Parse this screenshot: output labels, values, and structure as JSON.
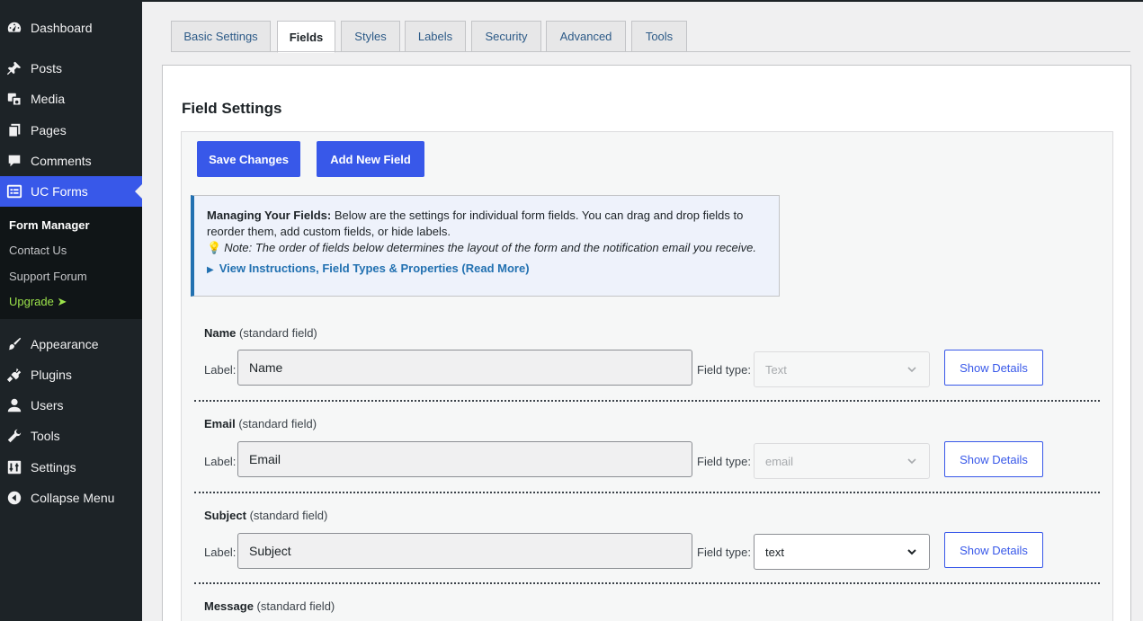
{
  "sidebar": {
    "items": [
      {
        "label": "Dashboard",
        "icon": "dashboard-icon"
      },
      {
        "label": "Posts",
        "icon": "pin-icon"
      },
      {
        "label": "Media",
        "icon": "media-icon"
      },
      {
        "label": "Pages",
        "icon": "pages-icon"
      },
      {
        "label": "Comments",
        "icon": "comment-icon"
      },
      {
        "label": "UC Forms",
        "icon": "forms-icon"
      },
      {
        "label": "Appearance",
        "icon": "paintbrush-icon"
      },
      {
        "label": "Plugins",
        "icon": "plugin-icon"
      },
      {
        "label": "Users",
        "icon": "user-icon"
      },
      {
        "label": "Tools",
        "icon": "wrench-icon"
      },
      {
        "label": "Settings",
        "icon": "settings-icon"
      },
      {
        "label": "Collapse Menu",
        "icon": "collapse-icon"
      }
    ],
    "submenu": [
      "Form Manager",
      "Contact Us",
      "Support Forum",
      "Upgrade ➤"
    ]
  },
  "tabs": [
    "Basic Settings",
    "Fields",
    "Styles",
    "Labels",
    "Security",
    "Advanced",
    "Tools"
  ],
  "panel": {
    "title": "Field Settings",
    "save_label": "Save Changes",
    "add_label": "Add New Field"
  },
  "notice": {
    "strong": "Managing Your Fields:",
    "text": " Below are the settings for individual form fields. You can drag and drop fields to reorder them, add custom fields, or hide labels.",
    "note": "Note: The order of fields below determines the layout of the form and the notification email you receive.",
    "link": "View Instructions, Field Types & Properties (Read More)"
  },
  "fields": [
    {
      "name": "Name",
      "tag": "(standard field)",
      "label_caption": "Label:",
      "value": "Name",
      "type_caption": "Field type:",
      "type": "Text",
      "button": "Show Details"
    },
    {
      "name": "Email",
      "tag": "(standard field)",
      "label_caption": "Label:",
      "value": "Email",
      "type_caption": "Field type:",
      "type": "email",
      "button": "Show Details"
    },
    {
      "name": "Subject",
      "tag": "(standard field)",
      "label_caption": "Label:",
      "value": "Subject",
      "type_caption": "Field type:",
      "type": "text",
      "button": "Show Details"
    },
    {
      "name": "Message",
      "tag": "(standard field)"
    }
  ],
  "colors": {
    "accent": "#3858e9",
    "sidebar": "#1d2327",
    "upgrade": "#9ce34b",
    "notice_border": "#2271b1"
  }
}
